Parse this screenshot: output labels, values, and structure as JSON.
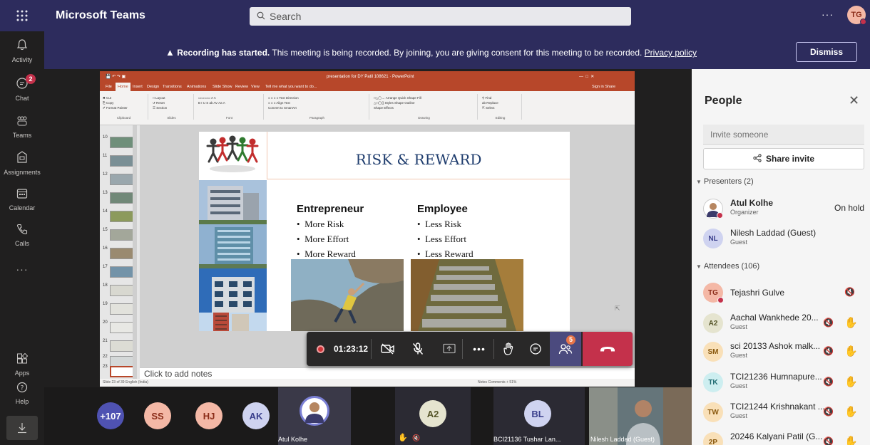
{
  "topbar": {
    "app_title": "Microsoft Teams",
    "search_placeholder": "Search",
    "more": "···",
    "user_initials": "TG"
  },
  "rail": {
    "items": [
      {
        "label": "Activity",
        "icon": "bell-icon"
      },
      {
        "label": "Chat",
        "icon": "chat-icon",
        "badge": "2"
      },
      {
        "label": "Teams",
        "icon": "teams-icon"
      },
      {
        "label": "Assignments",
        "icon": "assignments-icon"
      },
      {
        "label": "Calendar",
        "icon": "calendar-icon"
      },
      {
        "label": "Calls",
        "icon": "phone-icon"
      },
      {
        "label": "···",
        "icon": "more-icon"
      },
      {
        "label": "Apps",
        "icon": "apps-icon"
      },
      {
        "label": "Help",
        "icon": "help-icon"
      }
    ]
  },
  "banner": {
    "bold": "Recording has started.",
    "text": " This meeting is being recorded. By joining, you are giving consent for this meeting to be recorded. ",
    "link": "Privacy policy",
    "dismiss": "Dismiss"
  },
  "ppt": {
    "window_title": "presentation for DY Patil 108621 · PowerPoint",
    "tabs": [
      "File",
      "Home",
      "Insert",
      "Design",
      "Transitions",
      "Animations",
      "Slide Show",
      "Review",
      "View",
      "Tell me what you want to do..."
    ],
    "tabs_right": "Sign in  Share",
    "ribbon_groups": [
      "Clipboard",
      "Slides",
      "Font",
      "Paragraph",
      "Drawing",
      "Editing"
    ],
    "thumb_numbers": [
      "10",
      "11",
      "12",
      "13",
      "14",
      "15",
      "16",
      "17",
      "18",
      "19",
      "20",
      "21",
      "22",
      "23"
    ],
    "notes_placeholder": "Click to add notes",
    "status": "Slide 23 of 39   English (India)",
    "status_right": "Notes   Comments            + 51%"
  },
  "slide": {
    "title": "RISK & REWARD",
    "left_heading": "Entrepreneur",
    "left_bullets": [
      "More Risk",
      "More Effort",
      "More Reward"
    ],
    "right_heading": "Employee",
    "right_bullets": [
      "Less Risk",
      "Less Effort",
      "Less Reward"
    ]
  },
  "controls": {
    "timer": "01:23:12",
    "people_badge": "5"
  },
  "strip": {
    "overflow": "+107",
    "avatars": [
      "SS",
      "HJ",
      "AK"
    ],
    "atul_name": "Atul Kolhe",
    "a2": "A2",
    "bl": "BL",
    "bl_name": "BCI21136 Tushar Lan...",
    "nilesh_name": "Nilesh Laddad (Guest)"
  },
  "people": {
    "title": "People",
    "invite_placeholder": "Invite someone",
    "share_label": "Share invite",
    "presenters_header": "Presenters (2)",
    "attendees_header": "Attendees (106)",
    "presenters": [
      {
        "initials": "",
        "name": "Atul Kolhe",
        "role": "Organizer",
        "status": "On hold"
      },
      {
        "initials": "NL",
        "name": "Nilesh Laddad (Guest)",
        "role": "Guest"
      }
    ],
    "attendees": [
      {
        "initials": "TG",
        "name": "Tejashri Gulve",
        "role": ""
      },
      {
        "initials": "A2",
        "name": "Aachal Wankhede 20...",
        "role": "Guest"
      },
      {
        "initials": "SM",
        "name": "sci 20133 Ashok malk...",
        "role": "Guest"
      },
      {
        "initials": "TK",
        "name": "TCI21236 Humnapure...",
        "role": "Guest"
      },
      {
        "initials": "TW",
        "name": "TCI21244 Krishnakant ...",
        "role": "Guest"
      },
      {
        "initials": "2P",
        "name": "20246 Kalyani Patil (G...",
        "role": ""
      }
    ]
  },
  "colors": {
    "teams_purple": "#2d2c5d",
    "ppt_orange": "#b7472a",
    "leave_red": "#c4314b"
  }
}
